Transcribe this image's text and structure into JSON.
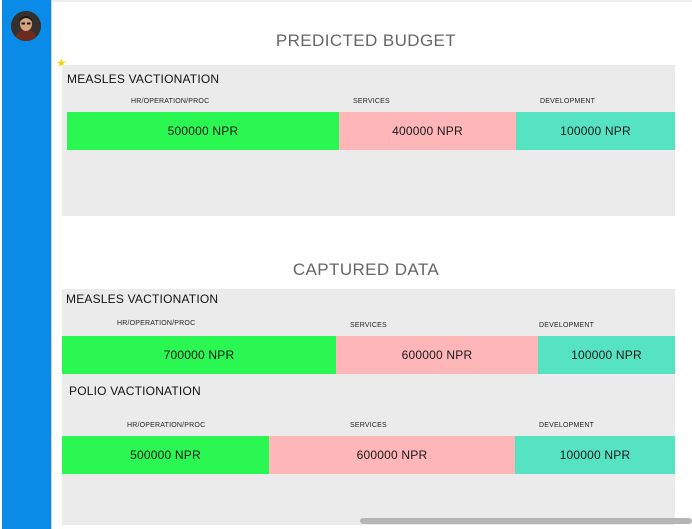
{
  "colors": {
    "sidebar": "#0a8be8",
    "hr": "#2bf752",
    "services": "#ffb6b9",
    "development": "#55e3c2",
    "card": "#ebebeb"
  },
  "sidebar": {
    "avatar_icon": "user-avatar"
  },
  "predicted": {
    "title": "PREDICTED BUDGET",
    "cards": [
      {
        "name": "MEASLES VACTIONATION",
        "labels": [
          "HR/OPERATION/PROC",
          "SERVICES",
          "DEVELOPMENT"
        ],
        "values": [
          "500000 NPR",
          "400000 NPR",
          "100000 NPR"
        ]
      }
    ]
  },
  "captured": {
    "title": "CAPTURED DATA",
    "cards": [
      {
        "name": "MEASLES VACTIONATION",
        "labels": [
          "HR/OPERATION/PROC",
          "SERVICES",
          "DEVELOPMENT"
        ],
        "values": [
          "700000 NPR",
          "600000 NPR",
          "100000 NPR"
        ]
      },
      {
        "name": "POLIO VACTIONATION",
        "labels": [
          "HR/OPERATION/PROC",
          "SERVICES",
          "DEVELOPMENT"
        ],
        "values": [
          "500000 NPR",
          "600000 NPR",
          "100000 NPR"
        ]
      }
    ]
  }
}
